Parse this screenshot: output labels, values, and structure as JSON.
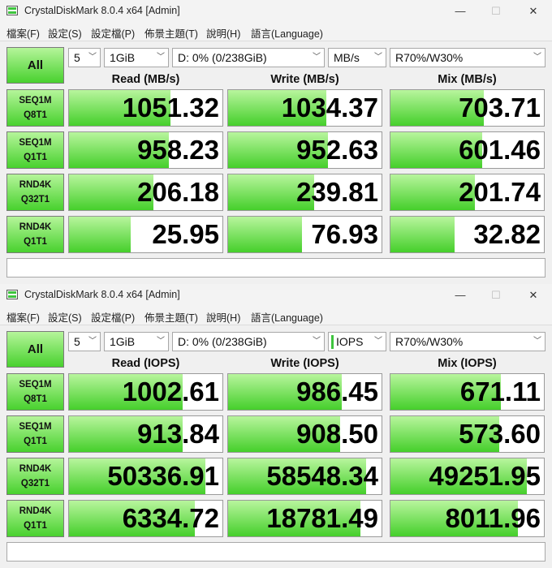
{
  "windows": [
    {
      "title": "CrystalDiskMark 8.0.4 x64 [Admin]",
      "caption": {
        "min": "—",
        "max": "☐",
        "close": "✕"
      },
      "menu": [
        "檔案(F)",
        "設定(S)",
        "設定檔(P)",
        "佈景主題(T)",
        "說明(H)",
        "語言(Language)"
      ],
      "all_label": "All",
      "count": "5",
      "size": "1GiB",
      "drive": "D: 0% (0/238GiB)",
      "unit": "MB/s",
      "mix": "R70%/W30%",
      "headers": {
        "read": "Read (MB/s)",
        "write": "Write (MB/s)",
        "mix": "Mix (MB/s)"
      },
      "rows": [
        {
          "l1": "SEQ1M",
          "l2": "Q8T1",
          "read": "1051.32",
          "write": "1034.37",
          "mix": "703.71",
          "read_fill": 0.66,
          "write_fill": 0.64,
          "mix_fill": 0.61
        },
        {
          "l1": "SEQ1M",
          "l2": "Q1T1",
          "read": "958.23",
          "write": "952.63",
          "mix": "601.46",
          "read_fill": 0.65,
          "write_fill": 0.65,
          "mix_fill": 0.6
        },
        {
          "l1": "RND4K",
          "l2": "Q32T1",
          "read": "206.18",
          "write": "239.81",
          "mix": "201.74",
          "read_fill": 0.55,
          "write_fill": 0.56,
          "mix_fill": 0.55
        },
        {
          "l1": "RND4K",
          "l2": "Q1T1",
          "read": "25.95",
          "write": "76.93",
          "mix": "32.82",
          "read_fill": 0.4,
          "write_fill": 0.48,
          "mix_fill": 0.42
        }
      ]
    },
    {
      "title": "CrystalDiskMark 8.0.4 x64 [Admin]",
      "caption": {
        "min": "—",
        "max": "☐",
        "close": "✕"
      },
      "menu": [
        "檔案(F)",
        "設定(S)",
        "設定檔(P)",
        "佈景主題(T)",
        "說明(H)",
        "語言(Language)"
      ],
      "all_label": "All",
      "count": "5",
      "size": "1GiB",
      "drive": "D: 0% (0/238GiB)",
      "unit": "IOPS",
      "mix": "R70%/W30%",
      "headers": {
        "read": "Read (IOPS)",
        "write": "Write (IOPS)",
        "mix": "Mix (IOPS)"
      },
      "rows": [
        {
          "l1": "SEQ1M",
          "l2": "Q8T1",
          "read": "1002.61",
          "write": "986.45",
          "mix": "671.11",
          "read_fill": 0.74,
          "write_fill": 0.74,
          "mix_fill": 0.72
        },
        {
          "l1": "SEQ1M",
          "l2": "Q1T1",
          "read": "913.84",
          "write": "908.50",
          "mix": "573.60",
          "read_fill": 0.74,
          "write_fill": 0.73,
          "mix_fill": 0.71
        },
        {
          "l1": "RND4K",
          "l2": "Q32T1",
          "read": "50336.91",
          "write": "58548.34",
          "mix": "49251.95",
          "read_fill": 0.89,
          "write_fill": 0.9,
          "mix_fill": 0.89
        },
        {
          "l1": "RND4K",
          "l2": "Q1T1",
          "read": "6334.72",
          "write": "18781.49",
          "mix": "8011.96",
          "read_fill": 0.82,
          "write_fill": 0.86,
          "mix_fill": 0.83
        }
      ]
    }
  ]
}
